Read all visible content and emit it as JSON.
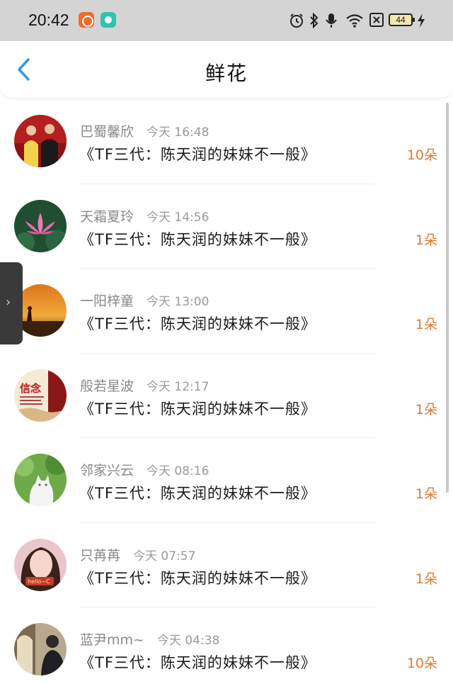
{
  "status_bar": {
    "time": "20:42",
    "icons": [
      "app-orange-icon",
      "app-teal-icon",
      "alarm-icon",
      "bluetooth-icon",
      "microphone-icon",
      "wifi-icon",
      "close-box-icon",
      "battery-icon",
      "charging-icon"
    ],
    "battery_level": "44"
  },
  "header": {
    "title": "鲜花",
    "back_icon": "chevron-left-icon"
  },
  "side_handle": {
    "icon": "›"
  },
  "items": [
    {
      "username": "巴蜀馨欣",
      "time": "今天 16:48",
      "title": "《TF三代：陈天润的妹妹不一般》",
      "count": "10朵",
      "avatar": "two-people"
    },
    {
      "username": "天霜夏玲",
      "time": "今天 14:56",
      "title": "《TF三代：陈天润的妹妹不一般》",
      "count": "1朵",
      "avatar": "lotus"
    },
    {
      "username": "一阳梓童",
      "time": "今天 13:00",
      "title": "《TF三代：陈天润的妹妹不一般》",
      "count": "1朵",
      "avatar": "sunset"
    },
    {
      "username": "般若星波",
      "time": "今天 12:17",
      "title": "《TF三代：陈天润的妹妹不一般》",
      "count": "1朵",
      "avatar": "xinnian"
    },
    {
      "username": "邻家兴云",
      "time": "今天 08:16",
      "title": "《TF三代：陈天润的妹妹不一般》",
      "count": "1朵",
      "avatar": "cat"
    },
    {
      "username": "只苒苒",
      "time": "今天 07:57",
      "title": "《TF三代：陈天润的妹妹不一般》",
      "count": "1朵",
      "avatar": "girl"
    },
    {
      "username": "蓝尹mm~",
      "time": "今天 04:38",
      "title": "《TF三代：陈天润的妹妹不一般》",
      "count": "10朵",
      "avatar": "person-street"
    }
  ],
  "avatar_texts": {
    "xinnian": "信念",
    "girl": "hello~C"
  }
}
